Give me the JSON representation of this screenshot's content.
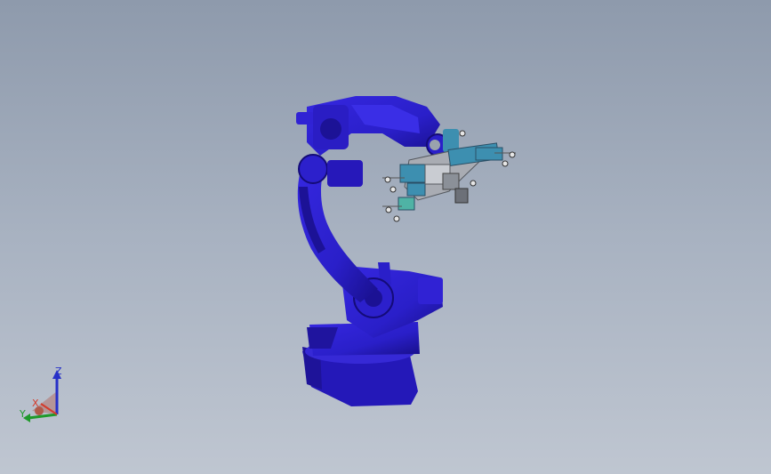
{
  "viewport": {
    "background_top": "#8e9aac",
    "background_bottom": "#bfc6d1"
  },
  "model": {
    "body_color": "#2a1fc9",
    "body_dark": "#1a128f",
    "fixture_color": "#a9acb3",
    "pad_color": "#3d8fb0",
    "pad_teal": "#4fb3a5"
  },
  "triad": {
    "z_label": "Z",
    "x_label": "X",
    "y_label": "Y",
    "z_color": "#2630c8",
    "x_color": "#d43b2b",
    "y_color": "#1f9a2a"
  }
}
